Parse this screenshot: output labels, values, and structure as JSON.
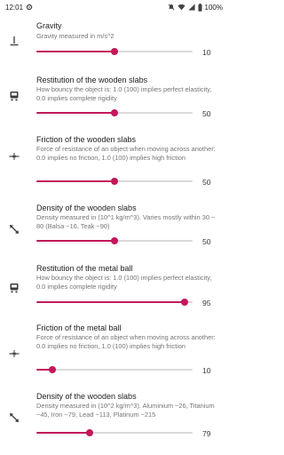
{
  "status_bar": {
    "time": "12:01",
    "battery": "100%"
  },
  "settings": [
    {
      "name": "gravity",
      "icon": "gravity-icon",
      "title": "Gravity",
      "summary": "Gravity measured in m/s^2",
      "value": "10",
      "fill": 0.5
    },
    {
      "name": "restitution-wooden-slabs",
      "icon": "bounce-icon",
      "title": "Restitution of the wooden slabs",
      "summary": "How bouncy the object is: 1.0 (100) implies perfect elasticity, 0.0 implies complete rigidity",
      "value": "50",
      "fill": 0.5
    },
    {
      "name": "friction-wooden-slabs",
      "icon": "friction-icon",
      "title": "Friction of the wooden slabs",
      "summary": "Force of resistance of an object when moving across another: 0.0 implies no friction, 1.0 (100) implies high friction",
      "value": "50",
      "fill": 0.5
    },
    {
      "name": "density-wooden-slabs",
      "icon": "density-icon",
      "title": "Density of the wooden slabs",
      "summary": "Density measured in (10^1 kg/m^3). Varies mostly within 30 ~ 80 (Balsa ~16, Teak ~90)",
      "value": "50",
      "fill": 0.5
    },
    {
      "name": "restitution-metal-ball",
      "icon": "bounce-icon",
      "title": "Restitution of the metal ball",
      "summary": "How bouncy the object is: 1.0 (100) implies perfect elasticity, 0.0 implies complete rigidity",
      "value": "95",
      "fill": 0.95
    },
    {
      "name": "friction-metal-ball",
      "icon": "friction-icon",
      "title": "Friction of the metal ball",
      "summary": "Force of resistance of an object when moving across another: 0.0 implies no friction, 1.0 (100) implies high friction",
      "value": "10",
      "fill": 0.1
    },
    {
      "name": "density-metal-ball",
      "icon": "density-icon",
      "title": "Density of the wooden slabs",
      "summary": "Density measured in (10^2 kg/m^3). Aluminium ~26, Titanium ~45, Iron ~79, Lead ~113, Platinum ~215",
      "value": "79",
      "fill": 0.34
    }
  ],
  "colors": {
    "accent": "#c2185b",
    "track": "#d9d9d9",
    "summary_text": "#757575"
  }
}
